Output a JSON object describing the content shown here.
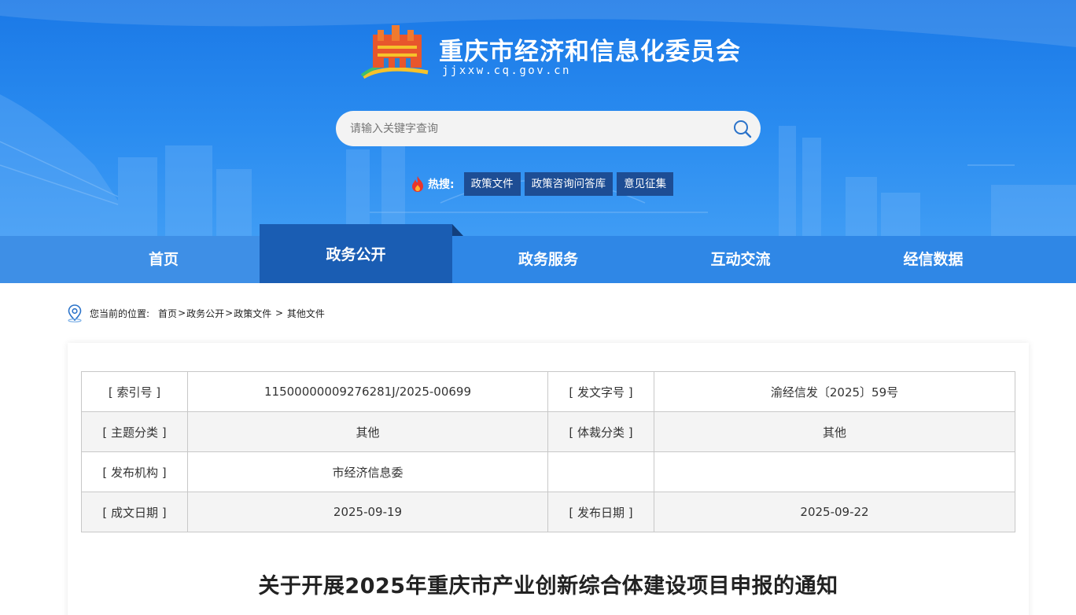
{
  "header": {
    "site_title": "重庆市经济和信息化委员会",
    "site_url": "jjxxw.cq.gov.cn",
    "search_placeholder": "请输入关键字查询",
    "hot_label": "热搜:",
    "hot_tags": [
      "政策文件",
      "政策咨询问答库",
      "意见征集"
    ]
  },
  "nav": {
    "items": [
      "首页",
      "政务公开",
      "政务服务",
      "互动交流",
      "经信数据"
    ],
    "active_index": 1
  },
  "breadcrumb": {
    "prefix": "您当前的位置:",
    "items": [
      "首页",
      "政务公开",
      "政策文件",
      "其他文件"
    ],
    "seps": [
      ">",
      ">",
      " > "
    ]
  },
  "meta": {
    "rows": [
      [
        "[ 索引号 ]",
        "11500000009276281J/2025-00699",
        "[ 发文字号 ]",
        "渝经信发〔2025〕59号"
      ],
      [
        "[ 主题分类 ]",
        "其他",
        "[ 体裁分类 ]",
        "其他"
      ],
      [
        "[ 发布机构 ]",
        "市经济信息委",
        "",
        ""
      ],
      [
        "[ 成文日期 ]",
        "2025-09-19",
        "[ 发布日期 ]",
        "2025-09-22"
      ]
    ]
  },
  "document": {
    "title": "关于开展2025年重庆市产业创新综合体建设项目申报的通知"
  },
  "colors": {
    "header_blue": "#1a78e6",
    "nav_blue": "#2f87e6",
    "nav_active": "#1a5db3",
    "hot_tag_bg": "#1d4d94"
  }
}
